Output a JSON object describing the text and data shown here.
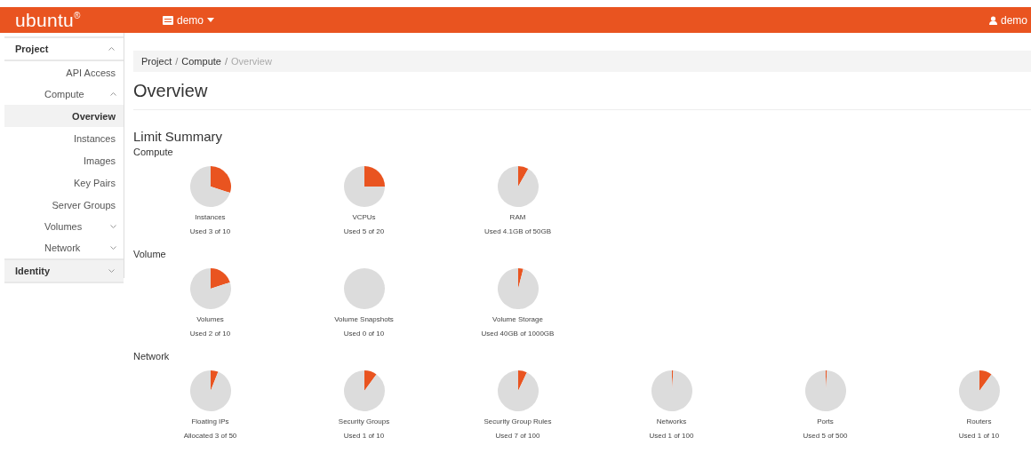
{
  "navbar": {
    "brand": "ubuntu",
    "brand_mark": "®",
    "project_menu": "demo",
    "user_menu": "demo"
  },
  "sidebar": [
    {
      "label": "Project",
      "expanded": true,
      "children": [
        {
          "label": "API Access",
          "selected": false
        },
        {
          "label": "Compute",
          "expanded": true,
          "children": [
            {
              "label": "Overview",
              "selected": true
            },
            {
              "label": "Instances",
              "selected": false
            },
            {
              "label": "Images",
              "selected": false
            },
            {
              "label": "Key Pairs",
              "selected": false
            },
            {
              "label": "Server Groups",
              "selected": false
            }
          ]
        },
        {
          "label": "Volumes",
          "expanded": false
        },
        {
          "label": "Network",
          "expanded": false
        }
      ]
    },
    {
      "label": "Identity",
      "expanded": false
    }
  ],
  "breadcrumb": [
    "Project",
    "Compute",
    "Overview"
  ],
  "breadcrumb_separator": "/",
  "page_title": "Overview",
  "section_title": "Limit Summary",
  "groups": [
    {
      "title": "Compute",
      "limits": [
        {
          "name": "Instances",
          "usage": "Used 3 of 10",
          "chart_data": {
            "type": "pie",
            "values": [
              30,
              70
            ]
          }
        },
        {
          "name": "VCPUs",
          "usage": "Used 5 of 20",
          "chart_data": {
            "type": "pie",
            "values": [
              25,
              75
            ]
          }
        },
        {
          "name": "RAM",
          "usage": "Used 4.1GB of 50GB",
          "chart_data": {
            "type": "pie",
            "values": [
              8.2,
              91.8
            ]
          }
        }
      ]
    },
    {
      "title": "Volume",
      "limits": [
        {
          "name": "Volumes",
          "usage": "Used 2 of 10",
          "chart_data": {
            "type": "pie",
            "values": [
              20,
              80
            ]
          }
        },
        {
          "name": "Volume Snapshots",
          "usage": "Used 0 of 10",
          "chart_data": {
            "type": "pie",
            "values": [
              0,
              100
            ]
          }
        },
        {
          "name": "Volume Storage",
          "usage": "Used 40GB of 1000GB",
          "chart_data": {
            "type": "pie",
            "values": [
              4,
              96
            ]
          }
        }
      ]
    },
    {
      "title": "Network",
      "limits": [
        {
          "name": "Floating IPs",
          "usage": "Allocated 3 of 50",
          "chart_data": {
            "type": "pie",
            "values": [
              6,
              94
            ]
          }
        },
        {
          "name": "Security Groups",
          "usage": "Used 1 of 10",
          "chart_data": {
            "type": "pie",
            "values": [
              10,
              90
            ]
          }
        },
        {
          "name": "Security Group Rules",
          "usage": "Used 7 of 100",
          "chart_data": {
            "type": "pie",
            "values": [
              7,
              93
            ]
          }
        },
        {
          "name": "Networks",
          "usage": "Used 1 of 100",
          "chart_data": {
            "type": "pie",
            "values": [
              1,
              99
            ]
          }
        },
        {
          "name": "Ports",
          "usage": "Used 5 of 500",
          "chart_data": {
            "type": "pie",
            "values": [
              1,
              99
            ]
          }
        },
        {
          "name": "Routers",
          "usage": "Used 1 of 10",
          "chart_data": {
            "type": "pie",
            "values": [
              10,
              90
            ]
          }
        }
      ]
    }
  ]
}
